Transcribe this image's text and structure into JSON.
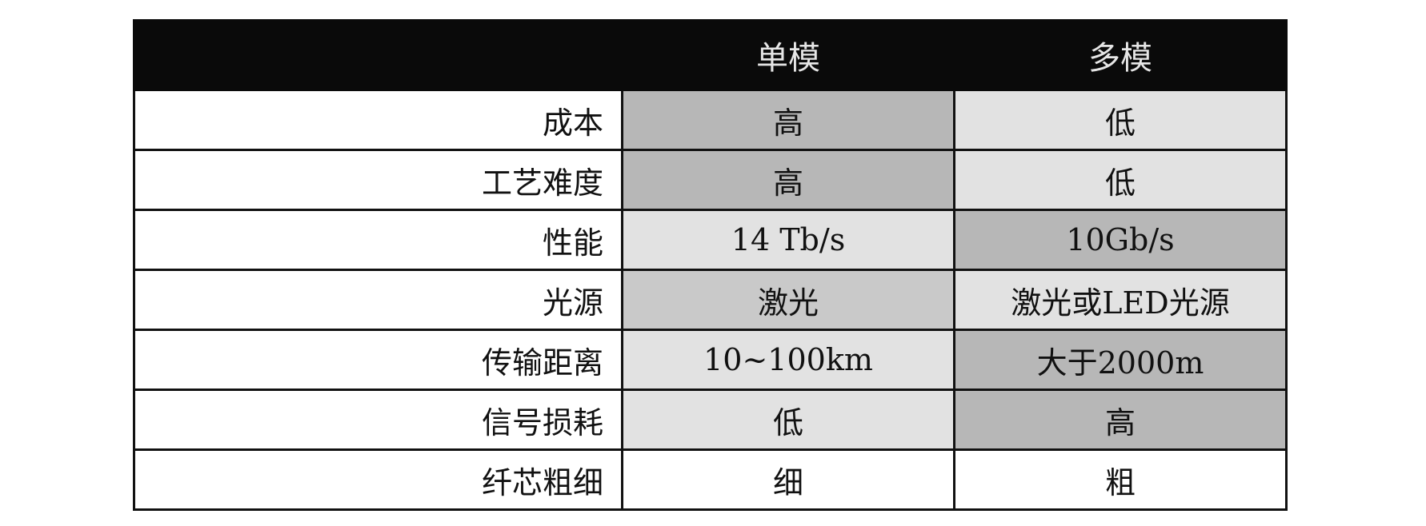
{
  "table": {
    "header": {
      "label_col": "",
      "single_mode": "单模",
      "multi_mode": "多模"
    },
    "rows": [
      {
        "label": "成本",
        "single": "高",
        "multi": "低",
        "single_shade": "dark",
        "multi_shade": "light"
      },
      {
        "label": "工艺难度",
        "single": "高",
        "multi": "低",
        "single_shade": "dark",
        "multi_shade": "light"
      },
      {
        "label": "性能",
        "single": "14 Tb/s",
        "multi": "10Gb/s",
        "single_shade": "light",
        "multi_shade": "dark"
      },
      {
        "label": "光源",
        "single": "激光",
        "multi": "激光或LED光源",
        "single_shade": "mid",
        "multi_shade": "light"
      },
      {
        "label": "传输距离",
        "single": "10~100km",
        "multi": "大于2000m",
        "single_shade": "light",
        "multi_shade": "dark"
      },
      {
        "label": "信号损耗",
        "single": "低",
        "multi": "高",
        "single_shade": "light",
        "multi_shade": "dark"
      },
      {
        "label": "纤芯粗细",
        "single": "细",
        "multi": "粗",
        "single_shade": "none",
        "multi_shade": "none"
      }
    ]
  },
  "colors": {
    "header_background": "#0a0a0a",
    "header_text": "#e6e6e6",
    "shade_dark": "#b7b7b7",
    "shade_mid": "#c9c9c9",
    "shade_light": "#e2e2e2",
    "border": "#111111"
  }
}
